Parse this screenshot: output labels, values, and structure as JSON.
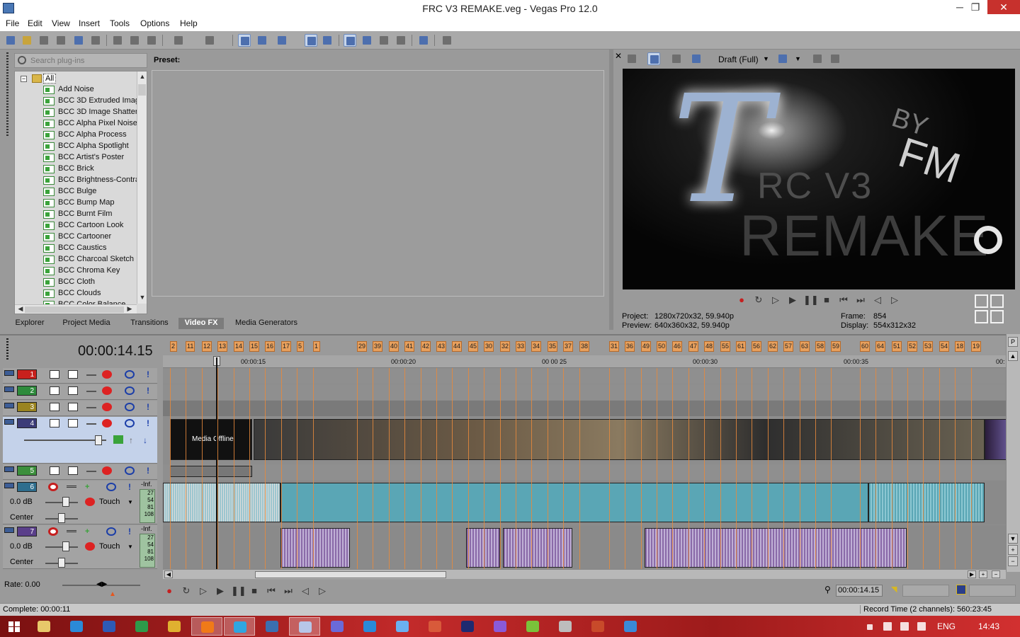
{
  "window": {
    "title": "FRC V3 REMAKE.veg - Vegas Pro 12.0",
    "minimize_glyph": "─",
    "restore_glyph": "❐",
    "close_glyph": "✕"
  },
  "menu": [
    "File",
    "Edit",
    "View",
    "Insert",
    "Tools",
    "Options",
    "Help"
  ],
  "plugins": {
    "search_placeholder": "Search plug-ins",
    "root_label": "All",
    "items": [
      "Add Noise",
      "BCC 3D Extruded Imag",
      "BCC 3D Image Shatter",
      "BCC Alpha Pixel Noise",
      "BCC Alpha Process",
      "BCC Alpha Spotlight",
      "BCC Artist's Poster",
      "BCC Brick",
      "BCC Brightness-Contra",
      "BCC Bulge",
      "BCC Bump Map",
      "BCC Burnt Film",
      "BCC Cartoon Look",
      "BCC Cartooner",
      "BCC Caustics",
      "BCC Charcoal Sketch",
      "BCC Chroma Key",
      "BCC Cloth",
      "BCC Clouds",
      "BCC Color Balance"
    ],
    "preset_label": "Preset:"
  },
  "window_tabs": [
    "Explorer",
    "Project Media",
    "Transitions",
    "Video FX",
    "Media Generators"
  ],
  "preview": {
    "quality": "Draft (Full)",
    "screen_text": {
      "rc_v3": "RC V3",
      "remake": "REMAKE",
      "by": "BY",
      "fm": "FM"
    },
    "project_label": "Project:",
    "project_value": "1280x720x32, 59.940p",
    "preview_label": "Preview:",
    "preview_value": "640x360x32, 59.940p",
    "frame_label": "Frame:",
    "frame_value": "854",
    "display_label": "Display:",
    "display_value": "554x312x32"
  },
  "timeline": {
    "current_time": "00:00:14.15",
    "markers": [
      "2",
      "11",
      "12",
      "13",
      "14",
      "15",
      "16",
      "17",
      "5",
      "1",
      "29",
      "39",
      "40",
      "41",
      "42",
      "43",
      "44",
      "45",
      "30",
      "32",
      "33",
      "34",
      "35",
      "37",
      "38",
      "31",
      "36",
      "49",
      "50",
      "46",
      "47",
      "48",
      "55",
      "61",
      "56",
      "62",
      "57",
      "63",
      "58",
      "59",
      "60",
      "64",
      "51",
      "52",
      "53",
      "54",
      "18",
      "19"
    ],
    "ruler_ticks": [
      "00:00:15",
      "00:00:20",
      "00 00 25",
      "00:00:30",
      "00:00:35",
      "00:"
    ],
    "media_offline": "Media Offline",
    "tracks": [
      {
        "num": "1",
        "color": "#c8201d",
        "type": "video"
      },
      {
        "num": "2",
        "color": "#2e8b3c",
        "type": "video"
      },
      {
        "num": "3",
        "color": "#9a8420",
        "type": "video"
      },
      {
        "num": "4",
        "color": "#3c3c78",
        "type": "video"
      },
      {
        "num": "5",
        "color": "#3c8f3c",
        "type": "video"
      },
      {
        "num": "6",
        "color": "#2f6e8e",
        "type": "audio",
        "vol": "0.0 dB",
        "pan": "Center",
        "mode": "Touch",
        "inf": "-Inf.",
        "meter": [
          "27",
          "54",
          "81",
          "108"
        ]
      },
      {
        "num": "7",
        "color": "#5a3f8a",
        "type": "audio",
        "vol": "0.0 dB",
        "pan": "Center",
        "mode": "Touch",
        "inf": "-Inf.",
        "meter": [
          "27",
          "54",
          "81",
          "108"
        ]
      }
    ]
  },
  "transport": {
    "rate": "Rate: 0.00",
    "time": "00:00:14.15"
  },
  "status": {
    "left": "Complete: 00:00:11",
    "right": "Record Time (2 channels): 560:23:45"
  },
  "taskbar": {
    "lang": "ENG",
    "clock": "14:43"
  }
}
